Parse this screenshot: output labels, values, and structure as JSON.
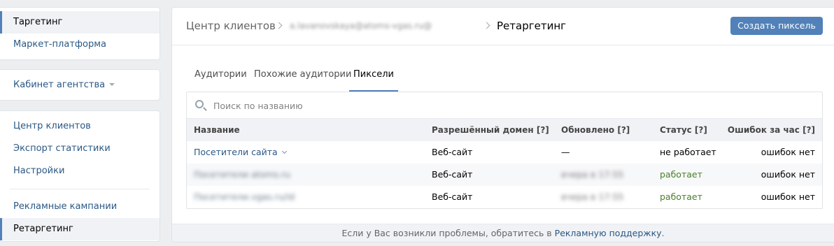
{
  "sidebar": {
    "block1": [
      {
        "label": "Таргетинг",
        "active": true
      },
      {
        "label": "Маркет-платформа",
        "active": false
      }
    ],
    "agency_cabinet": "Кабинет агентства",
    "block3": [
      {
        "label": "Центр клиентов"
      },
      {
        "label": "Экспорт статистики"
      },
      {
        "label": "Настройки"
      }
    ],
    "block3b": [
      {
        "label": "Рекламные кампании"
      },
      {
        "label": "Ретаргетинг",
        "active": true
      }
    ]
  },
  "header": {
    "crumb1": "Центр клиентов",
    "crumb2_redacted": "a.lavanovskaya@atoms-vgas.ru@",
    "crumb3": "Ретаргетинг",
    "create_button": "Создать пиксель"
  },
  "tabs": [
    {
      "label": "Аудитории",
      "active": false
    },
    {
      "label": "Похожие аудитории",
      "active": false
    },
    {
      "label": "Пиксели",
      "active": true
    }
  ],
  "search": {
    "placeholder": "Поиск по названию"
  },
  "table": {
    "columns": [
      "Название",
      "Разрешённый домен [?]",
      "Обновлено [?]",
      "Статус [?]",
      "Ошибок за час [?]"
    ],
    "rows": [
      {
        "name": "Посетители сайта",
        "domain": "Веб-сайт",
        "updated": "—",
        "status": "не работает",
        "errors": "ошибок нет"
      },
      {
        "name": "Посетители atoms.ru",
        "domain": "Веб-сайт",
        "updated": "вчера в 17:55",
        "status": "работает",
        "errors": "ошибок нет"
      },
      {
        "name": "Посетители.vgas.ru/id",
        "domain": "Веб-сайт",
        "updated": "вчера в 17:55",
        "status": "работает",
        "errors": "ошибок нет"
      }
    ]
  },
  "footer": {
    "text": "Если у Вас возникли проблемы, обратитесь в",
    "link": "Рекламную поддержку",
    "end": "."
  },
  "colors": {
    "accent": "#5181b8",
    "link": "#2a5885",
    "ok_status": "#4a7f2a",
    "page_bg": "#edeef0"
  }
}
